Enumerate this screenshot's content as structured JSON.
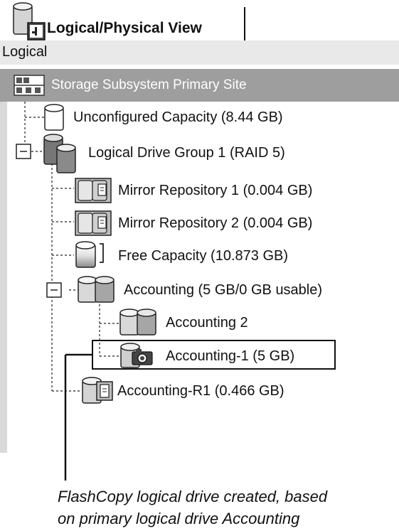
{
  "header": {
    "tab_title": "Logical/Physical View",
    "tab_icon": "drive-view-icon"
  },
  "section": {
    "label": "Logical"
  },
  "tree": {
    "root": {
      "label": "Storage Subsystem Primary Site",
      "icon": "storage-subsystem-icon"
    },
    "nodes": [
      {
        "label": "Unconfigured Capacity (8.44 GB)",
        "icon": "unconfigured-capacity-icon"
      },
      {
        "label": "Logical Drive Group 1 (RAID 5)",
        "icon": "drive-group-icon",
        "expanded": true
      },
      {
        "label": "Mirror Repository 1 (0.004 GB)",
        "icon": "mirror-repository-icon"
      },
      {
        "label": "Mirror Repository 2 (0.004 GB)",
        "icon": "mirror-repository-icon"
      },
      {
        "label": "Free Capacity (10.873 GB)",
        "icon": "free-capacity-icon"
      },
      {
        "label": "Accounting (5 GB/0 GB usable)",
        "icon": "logical-drive-icon",
        "expanded": true
      },
      {
        "label": "Accounting 2",
        "icon": "logical-drive-icon"
      },
      {
        "label": "Accounting-1 (5 GB)",
        "icon": "flashcopy-drive-icon"
      },
      {
        "label": "Accounting-R1 (0.466 GB)",
        "icon": "repository-drive-icon"
      }
    ]
  },
  "callout": {
    "line1": "FlashCopy logical drive created, based",
    "line2": "on primary logical drive Accounting"
  }
}
